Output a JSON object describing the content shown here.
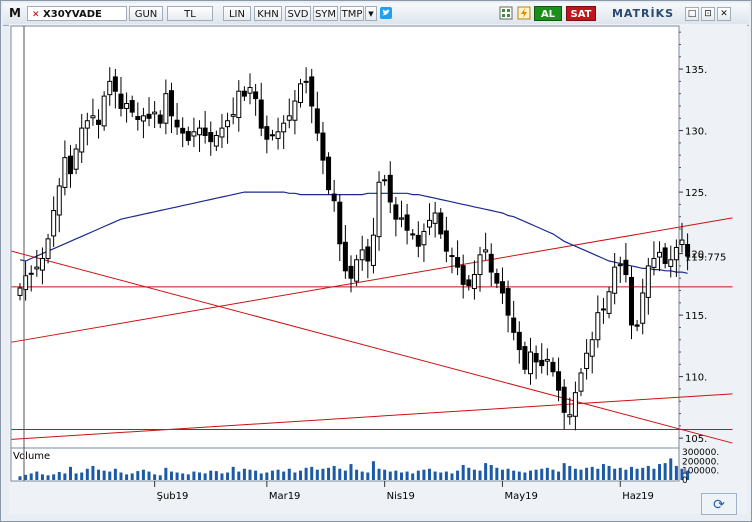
{
  "toolbar": {
    "logo": "M",
    "symbol": "X30YVADE",
    "buttons": [
      "GUN",
      "TL",
      "LIN",
      "KHN",
      "SVD",
      "SYM",
      "TMP"
    ],
    "dropdown_arrow": "▼",
    "twitter_icon": "twitter-icon",
    "buy_label": "AL",
    "sell_label": "SAT",
    "brand": "MATRİKS",
    "window_controls": [
      "□",
      "⊡",
      "✕"
    ]
  },
  "chart_data": {
    "type": "candlestick",
    "y_ticks": [
      "135.",
      "130.",
      "125.",
      "120.",
      "115.",
      "110.",
      "105."
    ],
    "y_tick_values": [
      135,
      130,
      125,
      120,
      115,
      110,
      105
    ],
    "last_price_label": "119.775",
    "last_price": 119.775,
    "ylim": [
      104.2,
      138.5
    ],
    "x_labels": [
      "Şub19",
      "Mar19",
      "Nis19",
      "May19",
      "Haz19"
    ],
    "x_label_index": [
      24,
      44,
      65,
      86,
      107
    ],
    "volume_label": "Volume",
    "volume_ticks": [
      "300000.",
      "200000.",
      "100000.",
      "0"
    ],
    "volume_tick_values": [
      300000,
      200000,
      100000,
      0
    ],
    "volume_max": 320000,
    "closes": [
      117.2,
      118.2,
      118.4,
      118.9,
      119.6,
      121.2,
      123.5,
      125.5,
      127.8,
      126.5,
      128.5,
      130.2,
      130.8,
      131.2,
      130.5,
      132.8,
      134.0,
      133.2,
      131.8,
      132.2,
      131.5,
      130.9,
      131.2,
      131.0,
      131.5,
      130.6,
      133.0,
      131.2,
      130.3,
      129.8,
      129.2,
      129.9,
      130.2,
      129.6,
      129.1,
      129.6,
      130.2,
      130.8,
      131.3,
      133.2,
      132.8,
      133.5,
      132.6,
      130.2,
      129.3,
      129.6,
      129.9,
      130.6,
      131.2,
      132.4,
      133.8,
      134.0,
      132.0,
      129.8,
      127.6,
      125.2,
      124.3,
      120.8,
      118.6,
      118.0,
      119.5,
      120.3,
      119.4,
      121.5,
      125.8,
      126.0,
      124.2,
      122.8,
      122.9,
      121.9,
      121.6,
      120.6,
      121.8,
      122.7,
      123.3,
      121.6,
      120.2,
      119.8,
      118.9,
      117.5,
      117.4,
      118.3,
      119.9,
      120.3,
      118.5,
      117.6,
      116.8,
      115.0,
      113.6,
      112.2,
      110.6,
      112.0,
      111.2,
      110.9,
      111.4,
      110.4,
      108.9,
      107.1,
      106.9,
      108.7,
      110.3,
      111.9,
      113.0,
      115.2,
      115.5,
      116.9,
      118.9,
      119.1,
      118.3,
      114.2,
      114.1,
      116.8,
      119.0,
      119.6,
      120.1,
      119.2,
      119.5,
      120.5,
      121.1,
      119.8
    ],
    "ma_values": [
      119.5,
      119.4,
      119.6,
      119.8,
      120.0,
      120.2,
      120.4,
      120.6,
      120.8,
      121.0,
      121.2,
      121.4,
      121.6,
      121.8,
      122.0,
      122.2,
      122.4,
      122.6,
      122.8,
      122.9,
      123.0,
      123.1,
      123.2,
      123.3,
      123.4,
      123.5,
      123.6,
      123.7,
      123.8,
      123.9,
      124.0,
      124.1,
      124.2,
      124.3,
      124.4,
      124.5,
      124.6,
      124.7,
      124.8,
      124.9,
      125.0,
      125.0,
      125.0,
      125.0,
      125.0,
      125.0,
      125.0,
      125.0,
      124.9,
      124.9,
      124.8,
      124.8,
      124.8,
      124.8,
      124.8,
      124.8,
      124.8,
      124.8,
      124.8,
      124.8,
      124.8,
      124.8,
      124.9,
      124.9,
      124.9,
      124.9,
      124.9,
      124.9,
      124.9,
      124.9,
      124.8,
      124.8,
      124.7,
      124.6,
      124.5,
      124.4,
      124.3,
      124.2,
      124.1,
      124.0,
      123.9,
      123.8,
      123.7,
      123.6,
      123.5,
      123.4,
      123.3,
      123.1,
      123.0,
      122.8,
      122.6,
      122.4,
      122.2,
      122.0,
      121.8,
      121.6,
      121.3,
      121.0,
      120.8,
      120.6,
      120.4,
      120.2,
      120.0,
      119.8,
      119.6,
      119.4,
      119.3,
      119.2,
      119.1,
      119.0,
      118.9,
      118.8,
      118.8,
      118.7,
      118.7,
      118.6,
      118.6,
      118.5,
      118.5,
      118.4
    ],
    "volumes": [
      40000,
      55000,
      70000,
      90000,
      60000,
      50000,
      60000,
      85000,
      70000,
      140000,
      70000,
      80000,
      120000,
      150000,
      110000,
      100000,
      90000,
      120000,
      80000,
      60000,
      70000,
      95000,
      110000,
      90000,
      60000,
      50000,
      130000,
      90000,
      80000,
      70000,
      60000,
      90000,
      80000,
      70000,
      100000,
      95000,
      70000,
      80000,
      140000,
      90000,
      120000,
      110000,
      100000,
      70000,
      80000,
      100000,
      110000,
      90000,
      120000,
      80000,
      100000,
      130000,
      140000,
      110000,
      120000,
      130000,
      150000,
      120000,
      100000,
      170000,
      110000,
      90000,
      80000,
      200000,
      120000,
      110000,
      90000,
      100000,
      80000,
      90000,
      70000,
      100000,
      110000,
      120000,
      90000,
      80000,
      90000,
      70000,
      100000,
      160000,
      130000,
      110000,
      100000,
      180000,
      160000,
      130000,
      110000,
      120000,
      100000,
      90000,
      80000,
      100000,
      110000,
      120000,
      130000,
      110000,
      90000,
      180000,
      150000,
      120000,
      110000,
      130000,
      140000,
      120000,
      170000,
      150000,
      120000,
      130000,
      110000,
      140000,
      120000,
      130000,
      150000,
      120000,
      170000,
      180000,
      230000,
      150000,
      120000,
      100000
    ],
    "trendlines": [
      {
        "x1": -1.5,
        "y1": 117.3,
        "x2": 127,
        "y2": 117.3
      },
      {
        "x1": -1.5,
        "y1": 105.7,
        "x2": 127,
        "y2": 105.7
      },
      {
        "x1": -1.5,
        "y1": 120.2,
        "x2": 127,
        "y2": 104.6
      },
      {
        "x1": -1.5,
        "y1": 112.8,
        "x2": 127,
        "y2": 122.9
      },
      {
        "x1": -1.5,
        "y1": 104.9,
        "x2": 127,
        "y2": 108.6
      }
    ],
    "colors": {
      "up": "#ffffff",
      "down": "#000000",
      "ma": "#1a2a8c",
      "trend": "#cc1111",
      "volume": "#1a5aa8",
      "background": "#ffffff"
    }
  }
}
